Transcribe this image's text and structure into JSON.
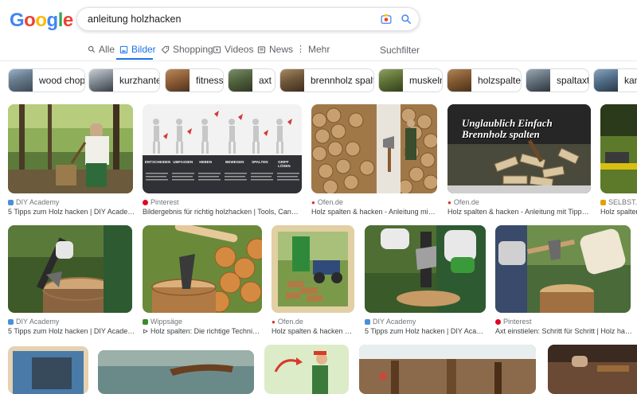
{
  "logo": {
    "letters": [
      "G",
      "o",
      "o",
      "g",
      "l",
      "e"
    ],
    "colors": [
      "#4285f4",
      "#ea4335",
      "#fbbc05",
      "#4285f4",
      "#34a853",
      "#ea4335"
    ]
  },
  "search": {
    "query": "anleitung holzhacken"
  },
  "tabs": [
    {
      "label": "Alle",
      "icon": "search-icon"
    },
    {
      "label": "Bilder",
      "icon": "image-icon",
      "active": true
    },
    {
      "label": "Shopping",
      "icon": "tag-icon"
    },
    {
      "label": "Videos",
      "icon": "play-icon"
    },
    {
      "label": "News",
      "icon": "news-icon"
    },
    {
      "label": "Mehr",
      "icon": "more-icon"
    }
  ],
  "filter_label": "Suchfilter",
  "chips": [
    "wood chops",
    "kurzhantel",
    "fitness",
    "axt",
    "brennholz spalten",
    "muskeln",
    "holzspalten",
    "spaltaxt",
    "kami"
  ],
  "row1": [
    {
      "source": "DIY Academy",
      "title": "5 Tipps zum Holz hacken | DIY Academy"
    },
    {
      "source": "Pinterest",
      "title": "Bildergebnis für richtig holzhacken | Tools, Canadian c..."
    },
    {
      "source": "Ofen.de",
      "title": "Holz spalten & hacken - Anleitung mit Tipp..."
    },
    {
      "source": "Ofen.de",
      "title": "Holz spalten & hacken - Anleitung mit Tipps! - ofe..."
    },
    {
      "source": "SELBST.de",
      "title": "Holz spalten"
    }
  ],
  "row2": [
    {
      "source": "DIY Academy",
      "title": "5 Tipps zum Holz hacken | DIY Academy"
    },
    {
      "source": "Wippsäge",
      "title": "⊳ Holz spalten: Die richtige Technik. So ..."
    },
    {
      "source": "Ofen.de",
      "title": "Holz spalten & hacken - An..."
    },
    {
      "source": "DIY Academy",
      "title": "5 Tipps zum Holz hacken | DIY Academy"
    },
    {
      "source": "Pinterest",
      "title": "Axt einstielen: Schritt für Schritt | Holz hacken,..."
    }
  ],
  "image_texts": {
    "poster": [
      "ENTSCHEIDEN",
      "UMFASSEN",
      "HEBEN",
      "BEWEGEN",
      "SPALTEN",
      "GRIFF LÖSEN"
    ],
    "banner": [
      "Unglaublich Einfach",
      "Brennholz spalten"
    ]
  },
  "colors": {
    "accent": "#1a73e8",
    "pinterest": "#e60023",
    "ofen": "#d93025",
    "diy": "#4a8fd9"
  }
}
